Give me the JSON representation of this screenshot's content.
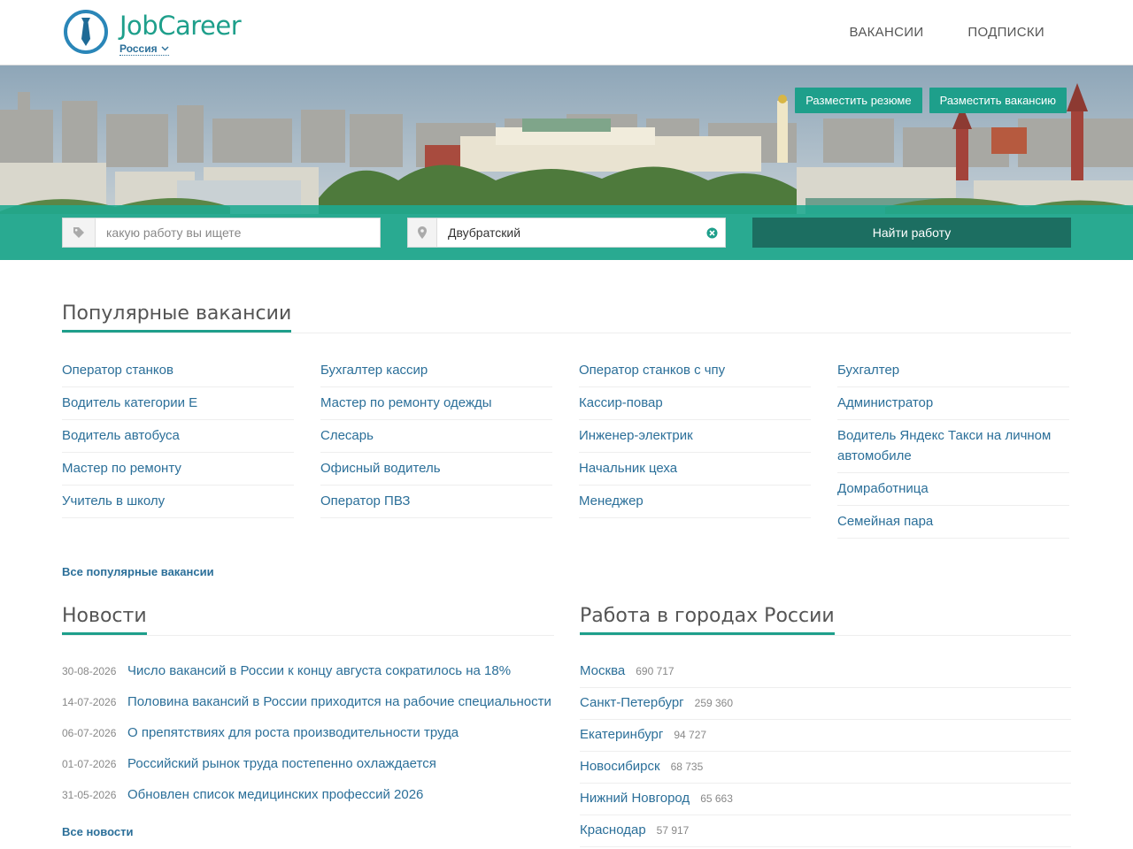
{
  "header": {
    "brand": "JobCareer",
    "region": "Россия",
    "nav": [
      "ВАКАНСИИ",
      "ПОДПИСКИ"
    ]
  },
  "hero": {
    "post_resume": "Разместить резюме",
    "post_vacancy": "Разместить вакансию"
  },
  "search": {
    "query_placeholder": "какую работу вы ищете",
    "location_value": "Двубратский",
    "button": "Найти работу"
  },
  "popular": {
    "title": "Популярные вакансии",
    "columns": [
      [
        "Оператор станков",
        "Водитель категории Е",
        "Водитель автобуса",
        "Мастер по ремонту",
        "Учитель в школу"
      ],
      [
        "Бухгалтер кассир",
        "Мастер по ремонту одежды",
        "Слесарь",
        "Офисный водитель",
        "Оператор ПВЗ"
      ],
      [
        "Оператор станков с чпу",
        "Кассир-повар",
        "Инженер-электрик",
        "Начальник цеха",
        "Менеджер"
      ],
      [
        "Бухгалтер",
        "Администратор",
        "Водитель Яндекс Такси на личном автомобиле",
        "Домработница",
        "Семейная пара"
      ]
    ],
    "all_link": "Все популярные вакансии"
  },
  "news": {
    "title": "Новости",
    "items": [
      {
        "date": "30-08-2026",
        "title": "Число вакансий в России к концу августа сократилось на 18%"
      },
      {
        "date": "14-07-2026",
        "title": "Половина вакансий в России приходится на рабочие специальности"
      },
      {
        "date": "06-07-2026",
        "title": "О препятствиях для роста производительности труда"
      },
      {
        "date": "01-07-2026",
        "title": "Российский рынок труда постепенно охлаждается"
      },
      {
        "date": "31-05-2026",
        "title": "Обновлен список медицинских профессий 2026"
      }
    ],
    "all_link": "Все новости"
  },
  "cities": {
    "title": "Работа в городах России",
    "items": [
      {
        "name": "Москва",
        "count": "690 717"
      },
      {
        "name": "Санкт-Петербург",
        "count": "259 360"
      },
      {
        "name": "Екатеринбург",
        "count": "94 727"
      },
      {
        "name": "Новосибирск",
        "count": "68 735"
      },
      {
        "name": "Нижний Новгород",
        "count": "65 663"
      },
      {
        "name": "Краснодар",
        "count": "57 917"
      }
    ]
  },
  "colors": {
    "brand": "#1e9f8b",
    "link": "#2b6f99",
    "search_button": "#1c6e61"
  }
}
